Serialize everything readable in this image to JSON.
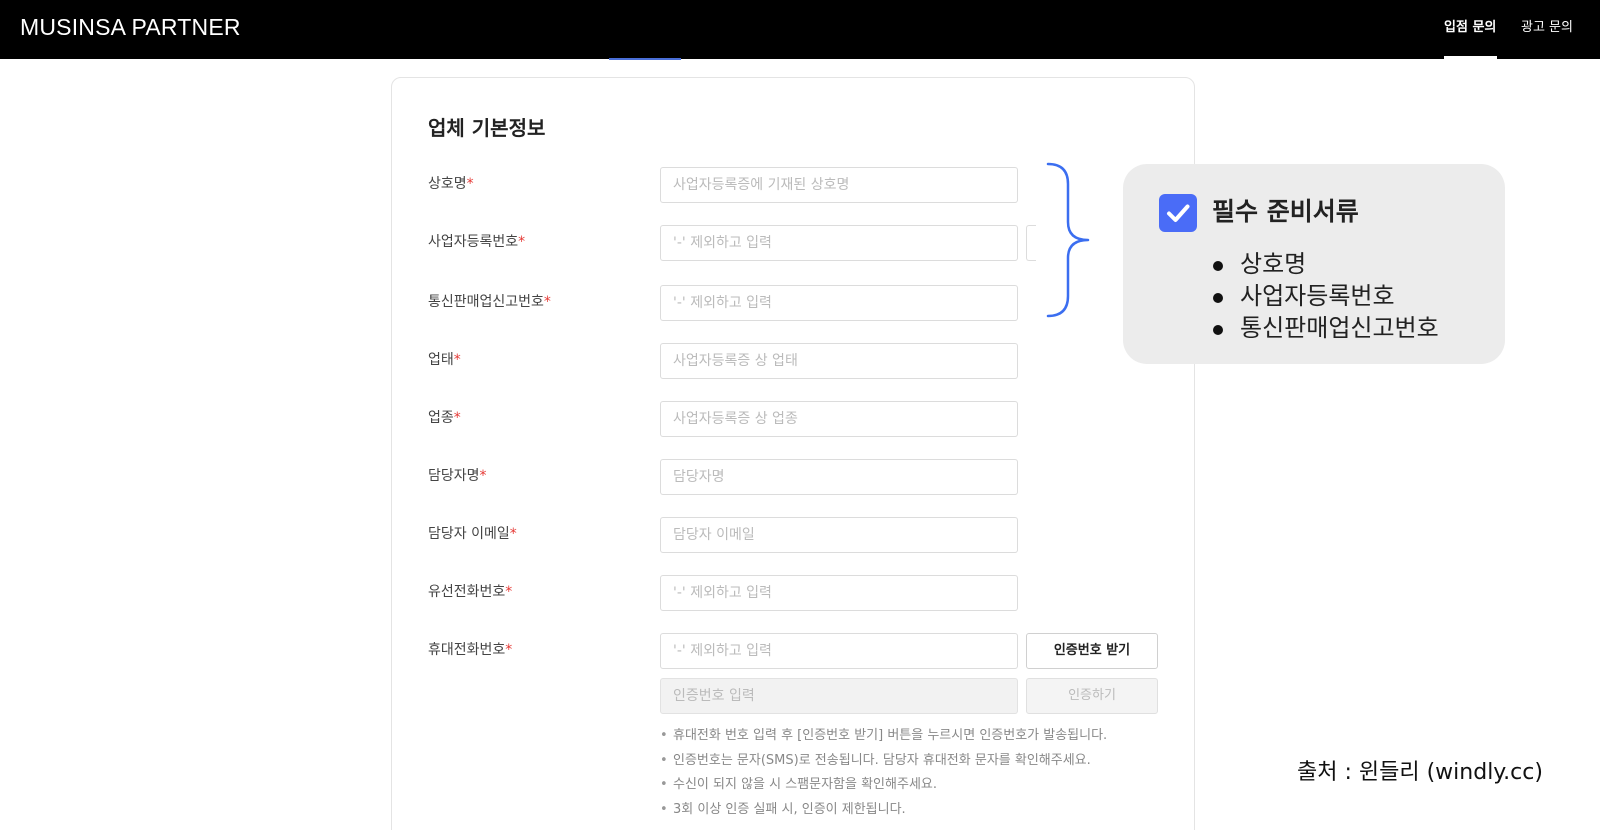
{
  "header": {
    "logo": "MUSINSA PARTNER",
    "nav": [
      "입점 문의",
      "광고 문의"
    ]
  },
  "form": {
    "section_title": "업체 기본정보",
    "required_mark": "*",
    "fields": [
      {
        "label": "상호명",
        "placeholder": "사업자등록증에 기재된 상호명"
      },
      {
        "label": "사업자등록번호",
        "placeholder": "'-' 제외하고 입력"
      },
      {
        "label": "통신판매업신고번호",
        "placeholder": "'-' 제외하고 입력"
      },
      {
        "label": "업태",
        "placeholder": "사업자등록증 상 업태"
      },
      {
        "label": "업종",
        "placeholder": "사업자등록증 상 업종"
      },
      {
        "label": "담당자명",
        "placeholder": "담당자명"
      },
      {
        "label": "담당자 이메일",
        "placeholder": "담당자 이메일"
      },
      {
        "label": "유선전화번호",
        "placeholder": "'-' 제외하고 입력"
      },
      {
        "label": "휴대전화번호",
        "placeholder": "'-' 제외하고 입력"
      }
    ],
    "verification": {
      "placeholder": "인증번호 입력",
      "request_button": "인증번호 받기",
      "verify_button": "인증하기"
    },
    "notes": [
      "휴대전화 번호 입력 후 [인증번호 받기] 버튼을 누르시면 인증번호가 발송됩니다.",
      "인증번호는 문자(SMS)로 전송됩니다. 담당자 휴대전화 문자를 확인해주세요.",
      "수신이 되지 않을 시 스팸문자함을 확인해주세요.",
      "3회 이상 인증 실패 시, 인증이 제한됩니다."
    ]
  },
  "callout": {
    "title": "필수 준비서류",
    "items": [
      "상호명",
      "사업자등록번호",
      "통신판매업신고번호"
    ],
    "checkbox_checked": true,
    "accent_color": "#4a6cf7"
  },
  "source": "출처 : 윈들리 (windly.cc)"
}
